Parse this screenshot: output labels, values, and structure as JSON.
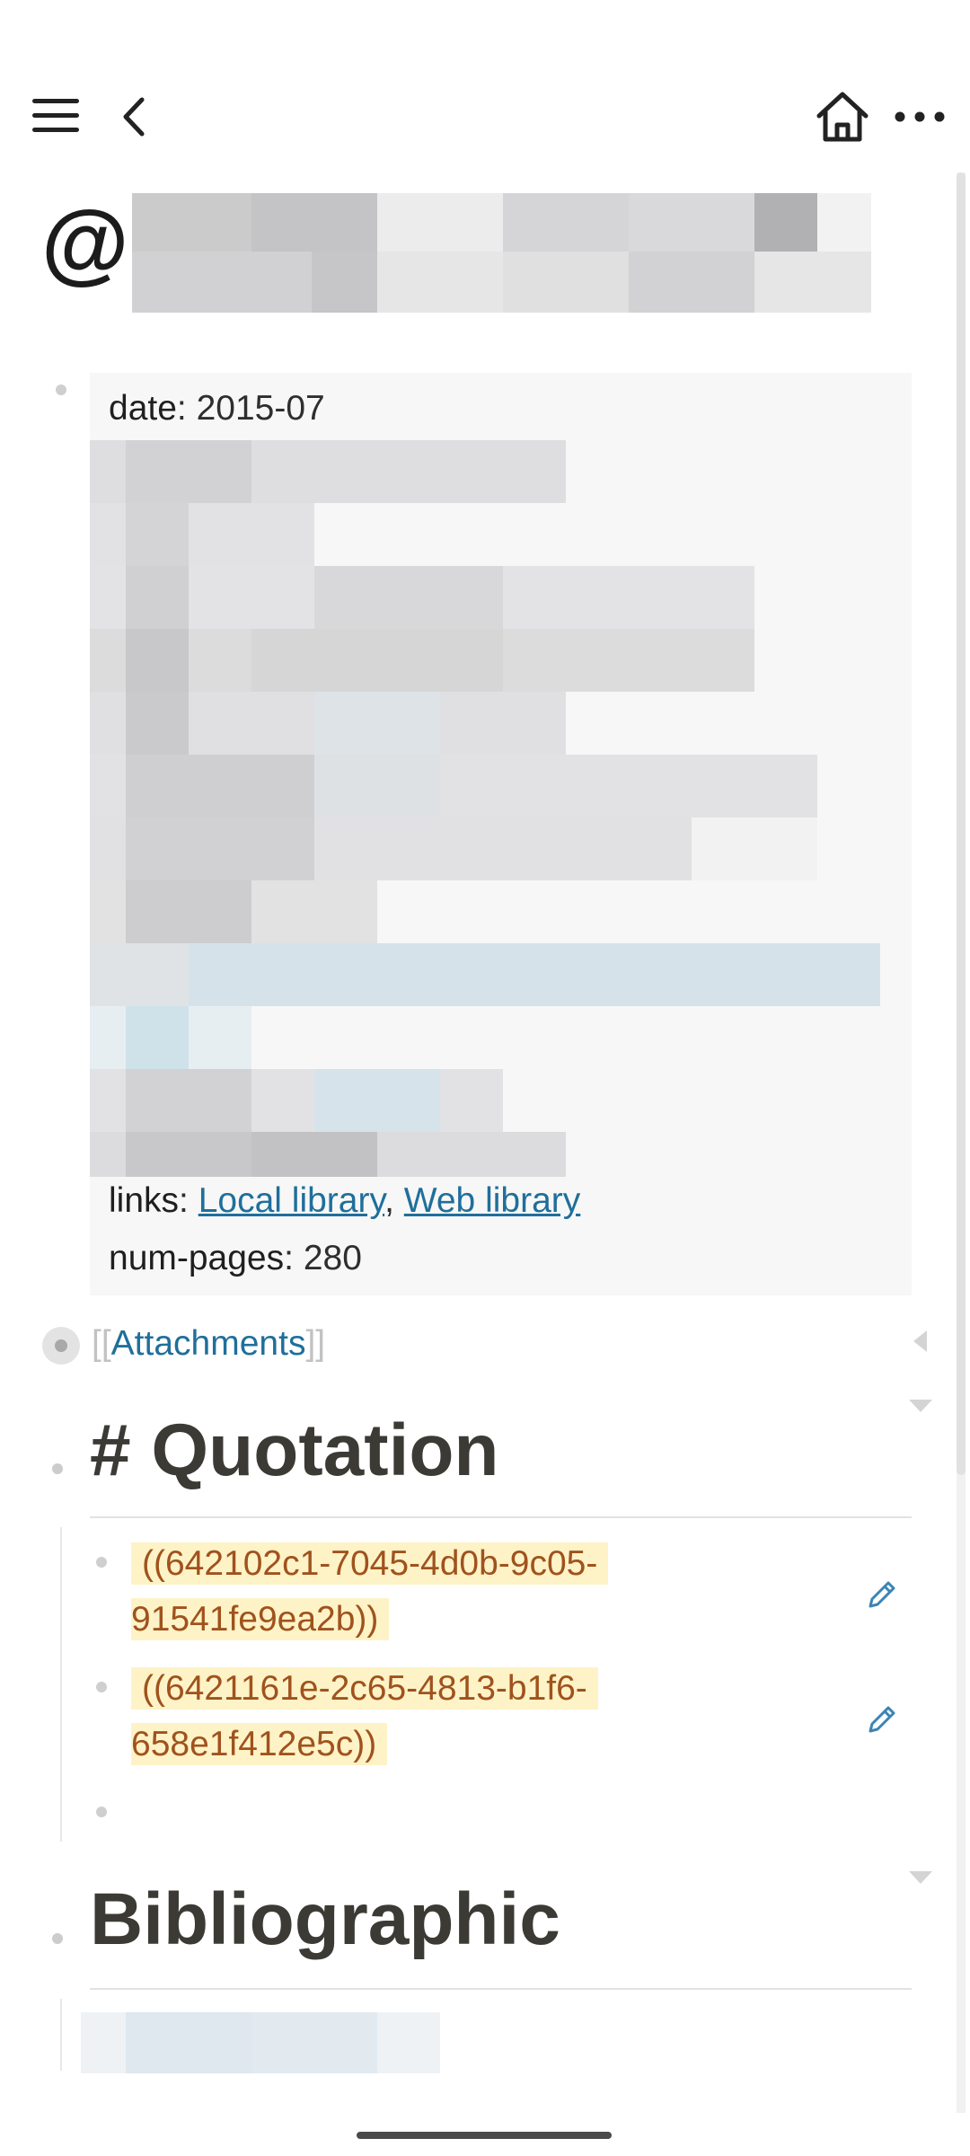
{
  "toolbar": {
    "menu_icon": "hamburger-menu-icon",
    "back_icon": "chevron-left-icon",
    "home_icon": "home-icon",
    "more_icon": "more-horizontal-icon"
  },
  "page": {
    "title_prefix": "@",
    "properties": {
      "date_key": "date",
      "date_value": "2015-07",
      "links_key": "links",
      "link_local": "Local library",
      "link_sep": ",",
      "link_web": "Web library",
      "pages_key": "num-pages",
      "pages_value": "280",
      "key_sep": ":"
    },
    "attachments": {
      "open": "[[",
      "label": "Attachments",
      "close": "]]"
    },
    "quotation": {
      "heading": "# Quotation",
      "refs": [
        {
          "line1": "((642102c1-7045-4d0b-9c05-",
          "line2": "91541fe9ea2b))"
        },
        {
          "line1": "((6421161e-2c65-4813-b1f6-",
          "line2": "658e1f412e5c))"
        }
      ]
    },
    "bibliographic": {
      "heading": "Bibliographic"
    }
  },
  "colors": {
    "link": "#1f6f9b",
    "ref_text": "#a0521d",
    "ref_highlight": "#fef3c7",
    "heading": "#3c3a35"
  }
}
